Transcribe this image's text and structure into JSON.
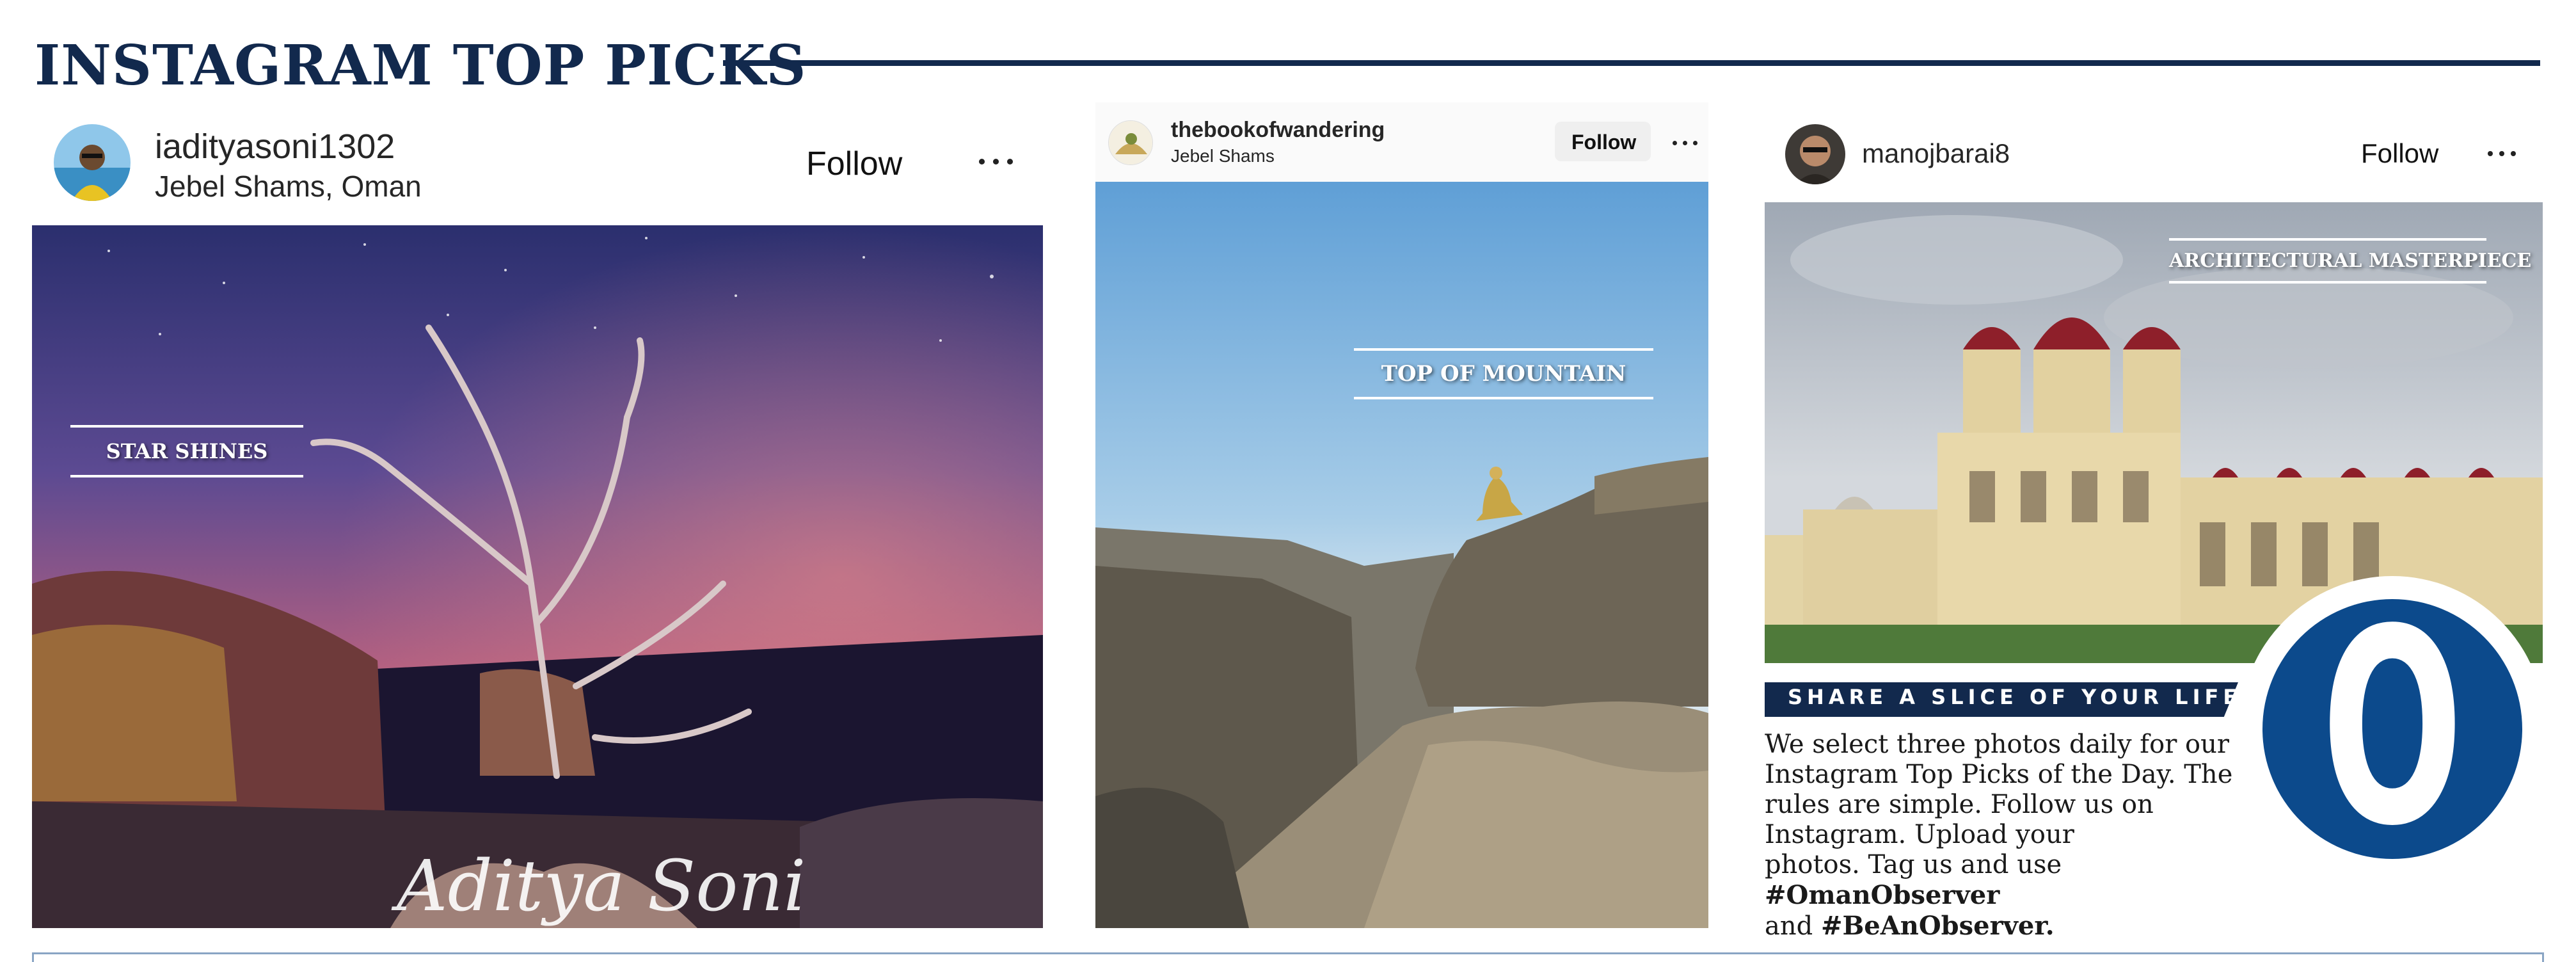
{
  "page": {
    "title": "INSTAGRAM TOP PICKS"
  },
  "posts": [
    {
      "username": "iadityasoni1302",
      "location": "Jebel Shams, Oman",
      "follow_label": "Follow",
      "photo": {
        "overlay_label": "STAR SHINES",
        "signature": "Aditya Soni"
      }
    },
    {
      "username": "thebookofwandering",
      "location": "Jebel Shams",
      "follow_label": "Follow",
      "photo": {
        "overlay_label": "TOP OF MOUNTAIN"
      }
    },
    {
      "username": "manojbarai8",
      "follow_label": "Follow",
      "photo": {
        "overlay_label": "ARCHITECTURAL MASTERPIECE"
      }
    }
  ],
  "promo": {
    "heading": "SHARE A SLICE OF YOUR LIFE",
    "body_line1": "We select three photos daily for our",
    "body_line2": "Instagram Top Picks of the Day. The",
    "body_line3": "rules are simple. Follow us on",
    "body_line4": "Instagram. Upload your",
    "body_line5_prefix": "photos. Tag us and use ",
    "hashtag1": "#OmanObserver",
    "body_line6_prefix": "and ",
    "hashtag2": "#BeAnObserver."
  },
  "logo": {
    "letter": "O",
    "color": "#0c4a8c"
  },
  "colors": {
    "navy": "#12294d",
    "frame": "#8aa5c4"
  },
  "icons": {
    "more": "more-horizontal-icon"
  }
}
